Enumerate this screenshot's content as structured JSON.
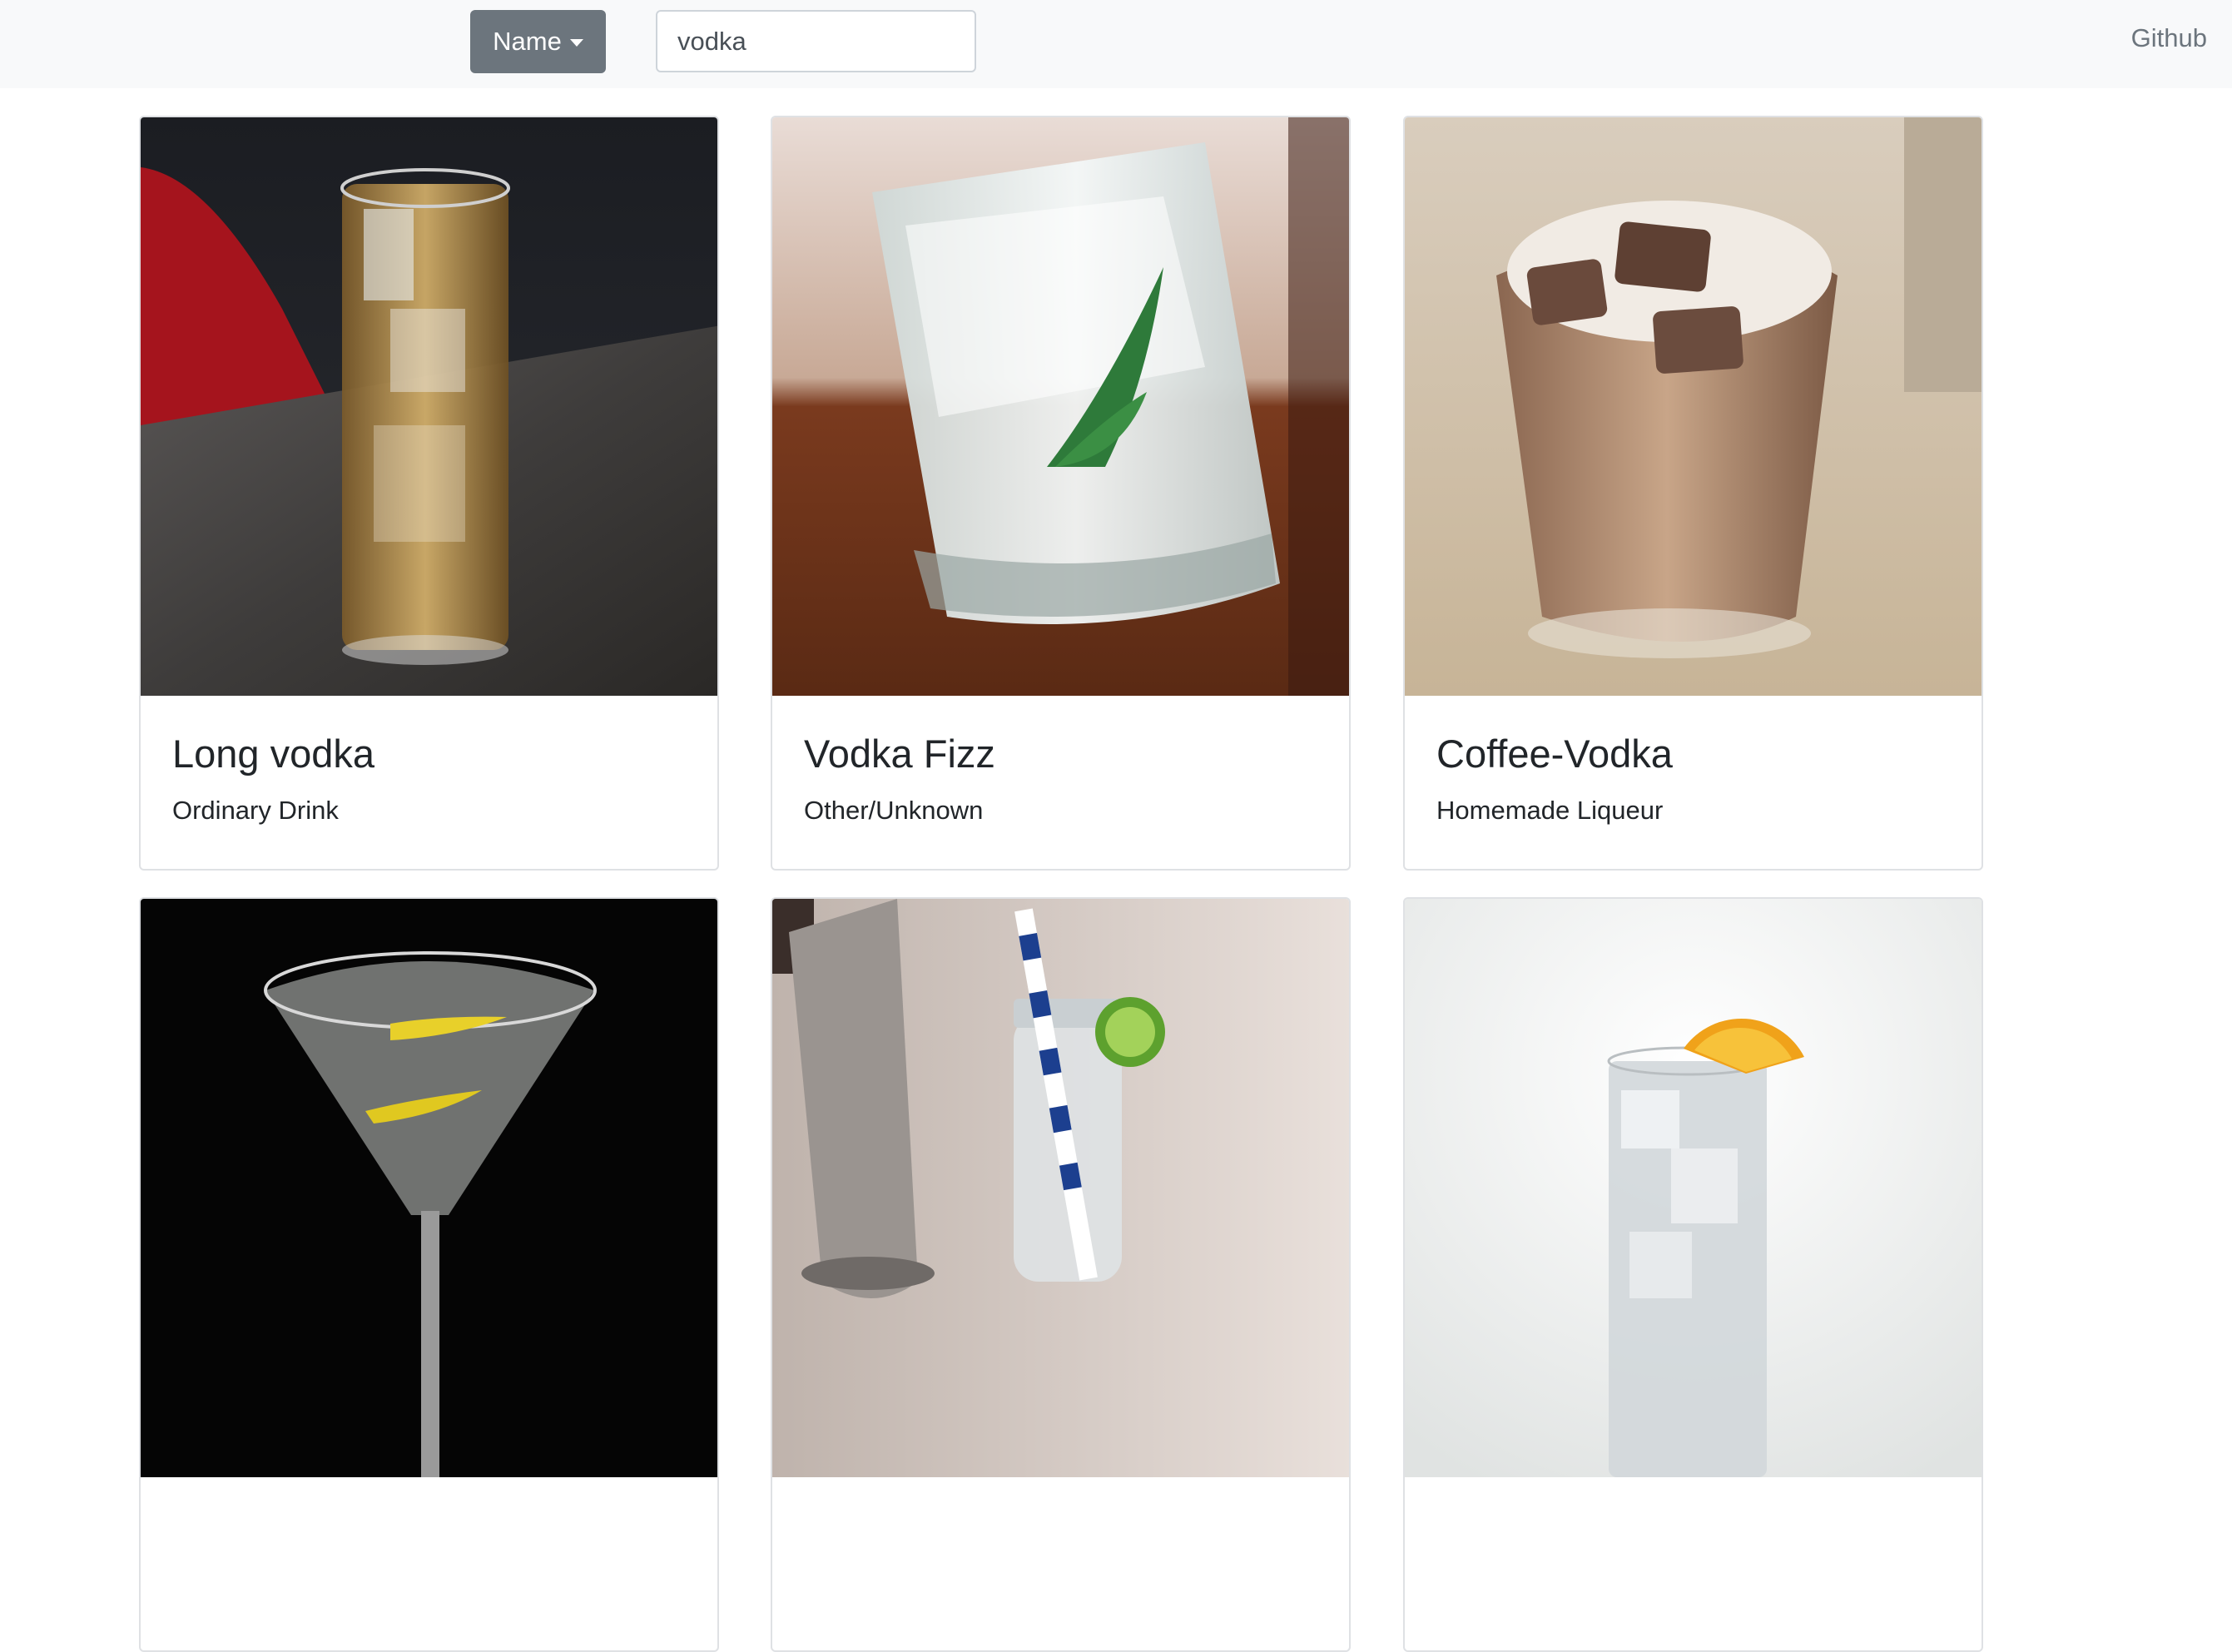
{
  "navbar": {
    "filter_label": "Name",
    "search_value": "vodka",
    "search_placeholder": "",
    "github_label": "Github"
  },
  "cards": [
    {
      "title": "Long vodka",
      "category": "Ordinary Drink"
    },
    {
      "title": "Vodka Fizz",
      "category": "Other/Unknown"
    },
    {
      "title": "Coffee-Vodka",
      "category": "Homemade Liqueur"
    },
    {
      "title": "",
      "category": ""
    },
    {
      "title": "",
      "category": ""
    },
    {
      "title": "",
      "category": ""
    }
  ],
  "colors": {
    "navbar_bg": "#f8f9fa",
    "button_bg": "#6c757d",
    "card_border": "#dfe1e4"
  }
}
